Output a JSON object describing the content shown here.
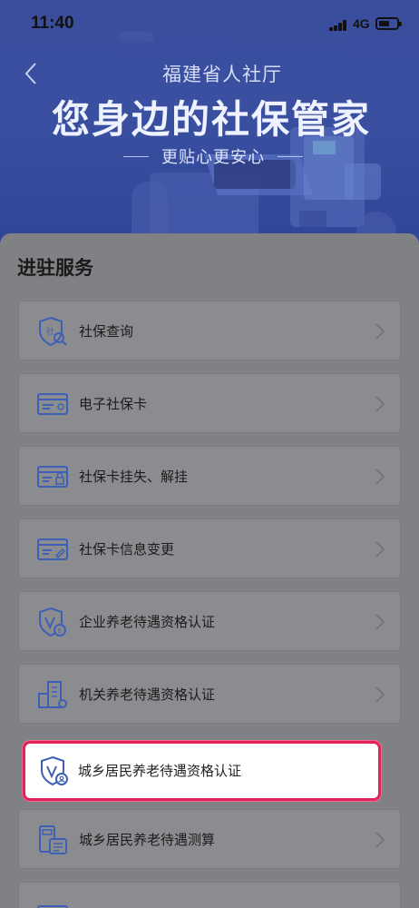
{
  "status_bar": {
    "time": "11:40",
    "network": "4G"
  },
  "header": {
    "org_name": "福建省人社厅",
    "slogan": "您身边的社保管家",
    "tagline": "更贴心更安心",
    "back_icon": "chevron-left-icon"
  },
  "section": {
    "title": "进驻服务"
  },
  "services": [
    {
      "label": "社保查询",
      "icon": "shield-search-icon"
    },
    {
      "label": "电子社保卡",
      "icon": "card-icon"
    },
    {
      "label": "社保卡挂失、解挂",
      "icon": "card-lock-icon"
    },
    {
      "label": "社保卡信息变更",
      "icon": "card-edit-icon"
    },
    {
      "label": "企业养老待遇资格认证",
      "icon": "shield-v-icon"
    },
    {
      "label": "机关养老待遇资格认证",
      "icon": "building-gear-icon"
    },
    {
      "label": "城乡居民养老待遇资格认证",
      "icon": "shield-v-icon",
      "highlighted": true
    },
    {
      "label": "城乡居民养老待遇测算",
      "icon": "calculator-doc-icon"
    },
    {
      "label": "",
      "icon": "card-icon"
    }
  ],
  "colors": {
    "banner": "#3a4fa0",
    "icon_blue": "#3d5fb5",
    "highlight_border": "#e0245a"
  }
}
